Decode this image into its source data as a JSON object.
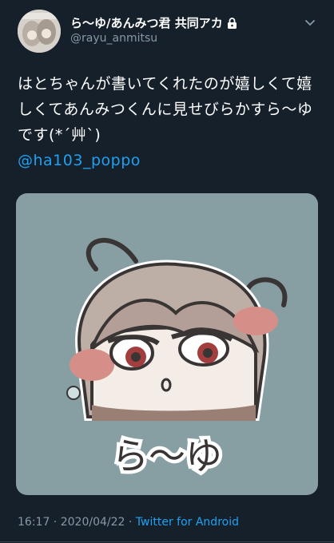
{
  "author": {
    "display_name": "ら〜ゆ/あんみつ君 共同アカ",
    "handle": "@rayu_anmitsu",
    "protected_icon": "lock-icon"
  },
  "menu_icon": "chevron-down-icon",
  "tweet": {
    "text": "はとちゃんが書いてくれたのが嬉しくて嬉しくてあんみつくんに見せびらかすら〜ゆです(*´艸`)",
    "mention": "@ha103_poppo"
  },
  "media": {
    "caption_text": "ら〜ゆ",
    "background_color": "#879fa3"
  },
  "meta": {
    "time": "16:17",
    "separator": " · ",
    "date": "2020/04/22",
    "source": "Twitter for Android"
  },
  "colors": {
    "background": "#15202b",
    "link": "#1da1f2",
    "secondary_text": "#8899a6"
  }
}
